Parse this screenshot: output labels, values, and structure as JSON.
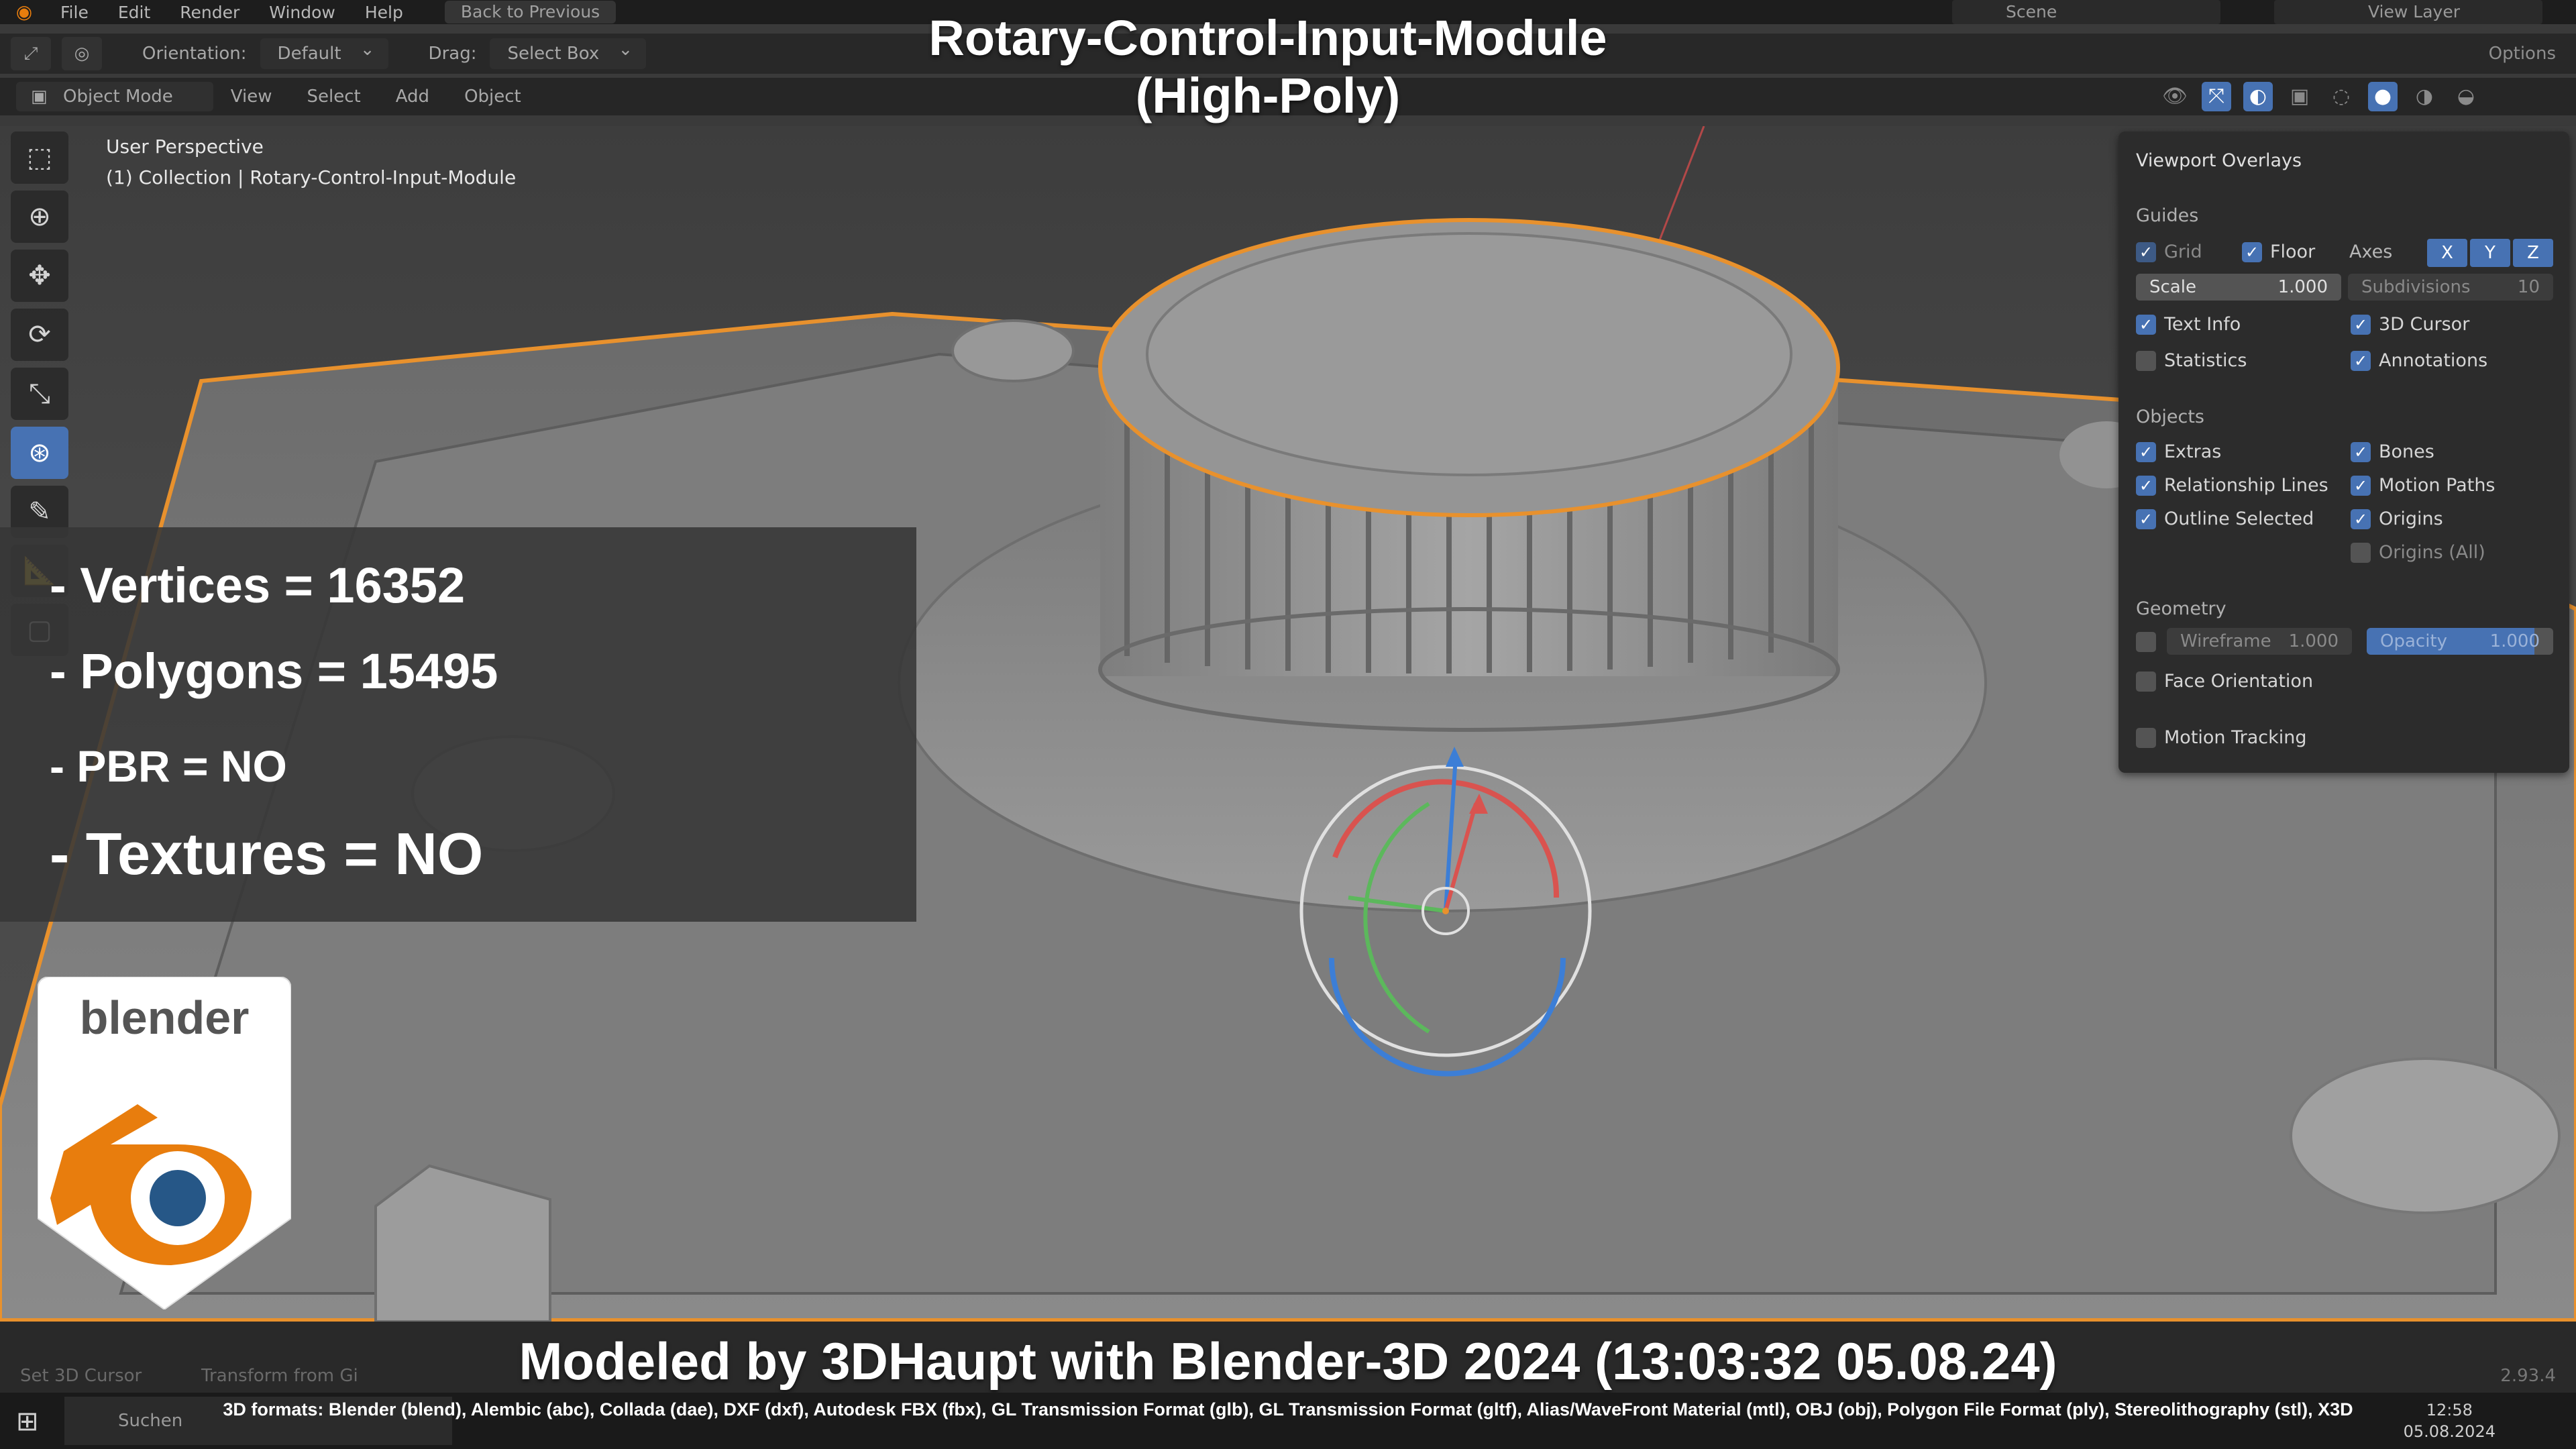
{
  "title": {
    "line1": "Rotary-Control-Input-Module",
    "line2": "(High-Poly)"
  },
  "menubar": {
    "items": [
      "File",
      "Edit",
      "Render",
      "Window",
      "Help"
    ],
    "back_button": "Back to Previous",
    "scene": "Scene",
    "view_layer": "View Layer"
  },
  "header": {
    "orientation_label": "Orientation:",
    "orientation_value": "Default",
    "drag_label": "Drag:",
    "drag_value": "Select Box",
    "options": "Options"
  },
  "mode_bar": {
    "mode": "Object Mode",
    "items": [
      "View",
      "Select",
      "Add",
      "Object"
    ]
  },
  "viewport_info": {
    "perspective": "User Perspective",
    "collection": "(1) Collection | Rotary-Control-Input-Module"
  },
  "stats": {
    "vertices": "- Vertices = 16352",
    "polygons": "- Polygons = 15495",
    "pbr": "- PBR =  NO",
    "textures": "- Textures = NO"
  },
  "badge": {
    "text": "blender"
  },
  "overlays": {
    "title": "Viewport Overlays",
    "guides_label": "Guides",
    "grid": "Grid",
    "floor": "Floor",
    "axes": "Axes",
    "axis_x": "X",
    "axis_y": "Y",
    "axis_z": "Z",
    "scale_label": "Scale",
    "scale_value": "1.000",
    "subdivisions_label": "Subdivisions",
    "subdivisions_value": "10",
    "text_info": "Text Info",
    "cursor_3d": "3D Cursor",
    "statistics": "Statistics",
    "annotations": "Annotations",
    "objects_label": "Objects",
    "extras": "Extras",
    "bones": "Bones",
    "relationship_lines": "Relationship Lines",
    "motion_paths": "Motion Paths",
    "outline_selected": "Outline Selected",
    "origins": "Origins",
    "origins_all": "Origins (All)",
    "geometry_label": "Geometry",
    "wireframe_label": "Wireframe",
    "wireframe_value": "1.000",
    "opacity_label": "Opacity",
    "opacity_value": "1.000",
    "face_orientation": "Face Orientation",
    "motion_tracking": "Motion Tracking"
  },
  "credit": "Modeled by 3DHaupt with Blender-3D 2024 (13:03:32  05.08.24)",
  "statusbar": {
    "set_cursor": "Set 3D Cursor",
    "transform": "Transform from Gi",
    "version": "2.93.4"
  },
  "formats": "3D formats: Blender (blend), Alembic (abc), Collada (dae), DXF (dxf), Autodesk FBX (fbx), GL Transmission Format (glb), GL Transmission Format (gltf), Alias/WaveFront Material (mtl), OBJ (obj), Polygon File Format (ply), Stereolithography (stl), X3D",
  "taskbar": {
    "search": "Suchen",
    "time": "12:58",
    "date": "05.08.2024"
  },
  "colors": {
    "accent": "#4772b3",
    "selection_outline": "#e8912d",
    "blender_orange": "#e87d0d",
    "blender_blue": "#265787"
  }
}
